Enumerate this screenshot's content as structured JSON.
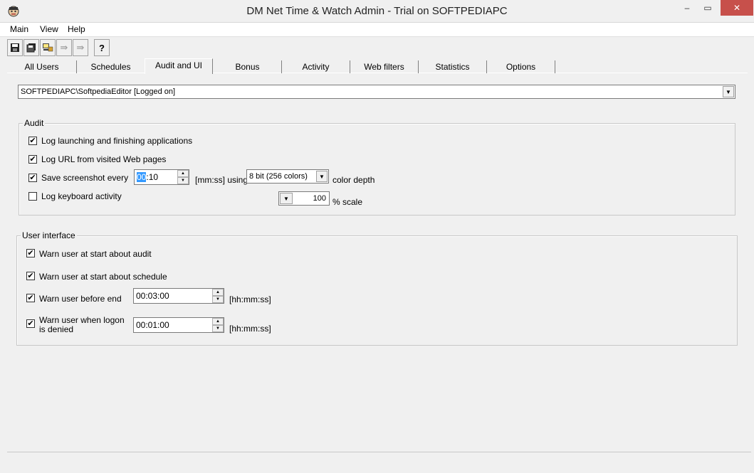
{
  "window": {
    "title": "DM Net Time & Watch Admin - Trial on SOFTPEDIAPC",
    "app_icon": "app-icon",
    "controls": {
      "minimize": "–",
      "maximize": "▭",
      "close": "✕"
    }
  },
  "menu": {
    "items": [
      "Main",
      "View",
      "Help"
    ]
  },
  "toolbar": {
    "buttons": [
      {
        "icon": "save-icon",
        "glyph": "💾"
      },
      {
        "icon": "copy-icon",
        "glyph": "▣"
      },
      {
        "icon": "computer-icon",
        "glyph": "🖳"
      },
      {
        "icon": "forward-icon",
        "glyph": "⇛"
      },
      {
        "icon": "forward-disabled-icon",
        "glyph": "⇛"
      },
      {
        "icon": "help-icon",
        "glyph": "?"
      }
    ]
  },
  "tabs": {
    "items": [
      "All Users",
      "Schedules",
      "Audit and UI",
      "Bonus",
      "Activity",
      "Web filters",
      "Statistics",
      "Options"
    ],
    "active": "Audit and UI"
  },
  "user_select": {
    "value": "SOFTPEDIAPC\\SoftpediaEditor  [Logged on]"
  },
  "audit": {
    "title": "Audit",
    "log_apps": {
      "label": "Log launching and finishing applications",
      "checked": true
    },
    "log_url": {
      "label": "Log URL from visited Web pages",
      "checked": true
    },
    "screenshot": {
      "label": "Save screenshot every",
      "checked": true,
      "value_selected": "00",
      "value_rest": ":10",
      "unit": "[mm:ss] using",
      "color_depth": "8 bit (256 colors)",
      "color_depth_label": "color depth",
      "scale_value": "100",
      "scale_label": "% scale"
    },
    "log_keyboard": {
      "label": "Log keyboard activity",
      "checked": false
    }
  },
  "ui": {
    "title": "User interface",
    "warn_audit": {
      "label": "Warn user at start about audit",
      "checked": true
    },
    "warn_schedule": {
      "label": "Warn user at start about schedule",
      "checked": true
    },
    "warn_end": {
      "label": "Warn user before end",
      "checked": true,
      "value": "00:03:00",
      "unit": "[hh:mm:ss]"
    },
    "warn_logon": {
      "label_line1": "Warn user when logon",
      "label_line2": "is denied",
      "checked": true,
      "value": "00:01:00",
      "unit": "[hh:mm:ss]"
    }
  },
  "colors": {
    "selection": "#3399ff",
    "close_button": "#c7504b",
    "background": "#f0f0f0"
  }
}
